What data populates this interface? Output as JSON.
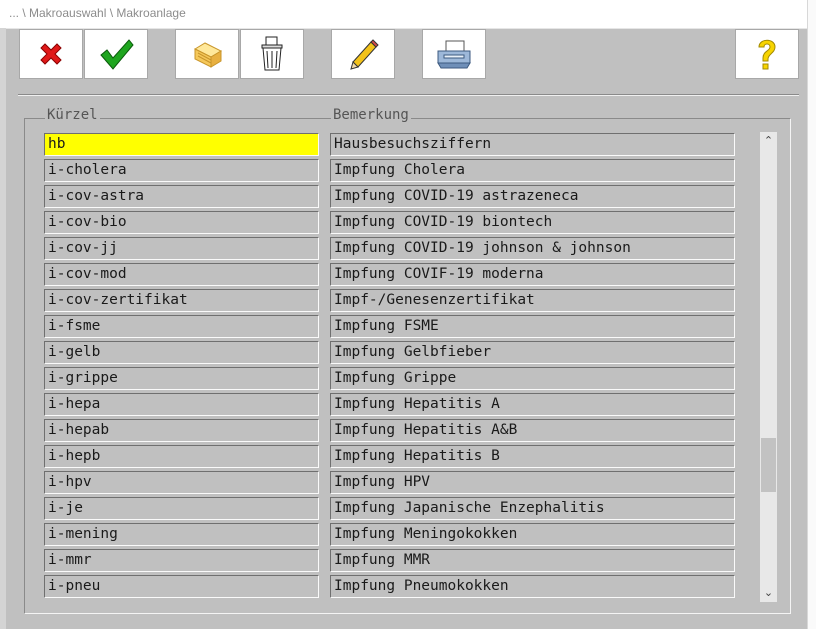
{
  "window": {
    "title": "... \\ Makroauswahl \\ Makroanlage"
  },
  "toolbar": {
    "buttons": [
      {
        "name": "cancel-button",
        "icon": "red-x-icon"
      },
      {
        "name": "confirm-button",
        "icon": "green-check-icon"
      },
      {
        "name": "folders-button",
        "icon": "folders-icon"
      },
      {
        "name": "delete-button",
        "icon": "trash-icon"
      },
      {
        "name": "edit-button",
        "icon": "pencil-icon"
      },
      {
        "name": "print-button",
        "icon": "printer-icon"
      },
      {
        "name": "help-button",
        "icon": "question-icon"
      }
    ]
  },
  "table": {
    "col_kuerzel": "Kürzel",
    "col_bemerkung": "Bemerkung",
    "rows": [
      {
        "kuerzel": "hb",
        "bemerkung": "Hausbesuchsziffern",
        "selected": true
      },
      {
        "kuerzel": "i-cholera",
        "bemerkung": "Impfung Cholera"
      },
      {
        "kuerzel": "i-cov-astra",
        "bemerkung": "Impfung COVID-19 astrazeneca"
      },
      {
        "kuerzel": "i-cov-bio",
        "bemerkung": "Impfung COVID-19 biontech"
      },
      {
        "kuerzel": "i-cov-jj",
        "bemerkung": "Impfung COVID-19 johnson & johnson"
      },
      {
        "kuerzel": "i-cov-mod",
        "bemerkung": "Impfung COVIF-19 moderna"
      },
      {
        "kuerzel": "i-cov-zertifikat",
        "bemerkung": "Impf-/Genesenzertifikat"
      },
      {
        "kuerzel": "i-fsme",
        "bemerkung": "Impfung FSME"
      },
      {
        "kuerzel": "i-gelb",
        "bemerkung": "Impfung Gelbfieber"
      },
      {
        "kuerzel": "i-grippe",
        "bemerkung": "Impfung Grippe"
      },
      {
        "kuerzel": "i-hepa",
        "bemerkung": "Impfung Hepatitis A"
      },
      {
        "kuerzel": "i-hepab",
        "bemerkung": "Impfung Hepatitis A&B"
      },
      {
        "kuerzel": "i-hepb",
        "bemerkung": "Impfung Hepatitis B"
      },
      {
        "kuerzel": "i-hpv",
        "bemerkung": "Impfung HPV"
      },
      {
        "kuerzel": "i-je",
        "bemerkung": "Impfung Japanische Enzephalitis"
      },
      {
        "kuerzel": "i-mening",
        "bemerkung": "Impfung Meningokokken"
      },
      {
        "kuerzel": "i-mmr",
        "bemerkung": "Impfung MMR"
      },
      {
        "kuerzel": "i-pneu",
        "bemerkung": "Impfung Pneumokokken"
      }
    ]
  },
  "scrollbar": {
    "up": "⌃",
    "down": "⌄"
  },
  "colors": {
    "selected_row": "#ffff00",
    "window_bg": "#c0c0c0"
  }
}
